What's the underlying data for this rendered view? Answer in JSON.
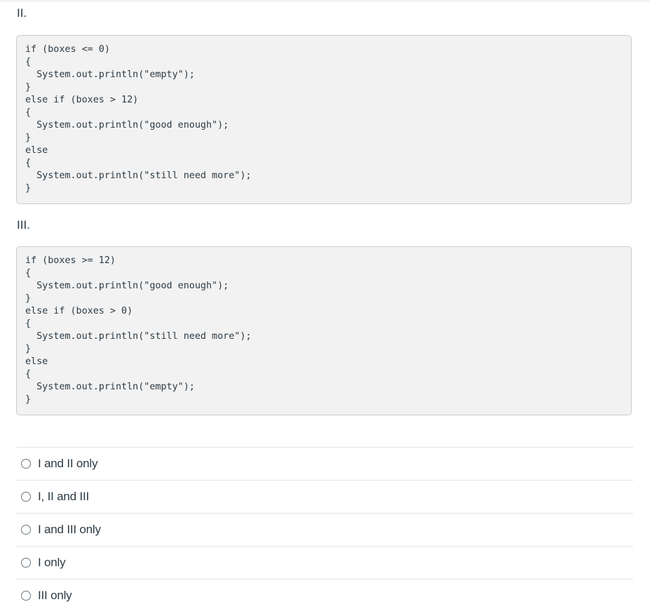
{
  "question": {
    "option_ii": {
      "label": "II.",
      "code": "if (boxes <= 0)\n{\n  System.out.println(\"empty\");\n}\nelse if (boxes > 12)\n{\n  System.out.println(\"good enough\");\n}\nelse\n{\n  System.out.println(\"still need more\");\n}"
    },
    "option_iii": {
      "label": "III.",
      "code": "if (boxes >= 12)\n{\n  System.out.println(\"good enough\");\n}\nelse if (boxes > 0)\n{\n  System.out.println(\"still need more\");\n}\nelse\n{\n  System.out.println(\"empty\");\n}"
    }
  },
  "answers": [
    {
      "label": "I and II only",
      "selected": false
    },
    {
      "label": "I, II and III",
      "selected": false
    },
    {
      "label": "I and III only",
      "selected": false
    },
    {
      "label": "I only",
      "selected": false
    },
    {
      "label": "III only",
      "selected": false
    }
  ]
}
